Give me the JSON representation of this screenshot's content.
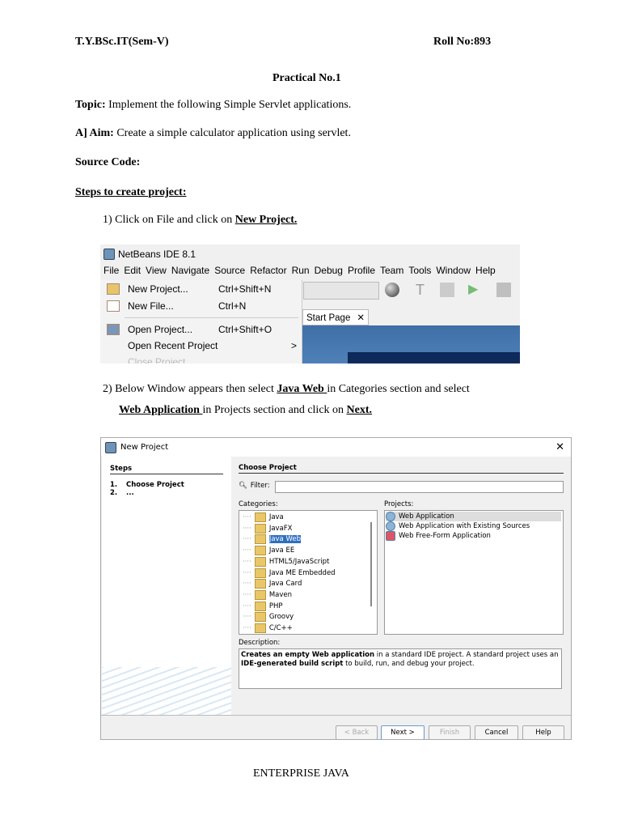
{
  "header": {
    "class": "T.Y.BSc.IT(Sem-V)",
    "roll": "Roll No:893"
  },
  "title": "Practical No.1",
  "topic": {
    "label": "Topic:",
    "text": " Implement the following Simple Servlet applications."
  },
  "aim": {
    "label": "A] Aim:",
    "text": " Create a simple calculator application using servlet."
  },
  "source_code": "Source Code:",
  "steps_heading": "Steps to create project:",
  "step1": {
    "text": "1) Click on File and click on ",
    "link": "New Project."
  },
  "step2": {
    "a": "2) Below Window appears then select ",
    "b": "Java Web ",
    "c": "in Categories  section and select",
    "d": "Web Application ",
    "e": "in Projects section and  click on ",
    "f": "Next."
  },
  "ide": {
    "title": "NetBeans IDE 8.1",
    "menu": [
      "File",
      "Edit",
      "View",
      "Navigate",
      "Source",
      "Refactor",
      "Run",
      "Debug",
      "Profile",
      "Team",
      "Tools",
      "Window",
      "Help"
    ],
    "file_menu": [
      {
        "label": "New Project...",
        "key": "Ctrl+Shift+N"
      },
      {
        "label": "New File...",
        "key": "Ctrl+N"
      },
      {
        "label": "Open Project...",
        "key": "Ctrl+Shift+O"
      },
      {
        "label": "Open Recent Project",
        "key": ">"
      },
      {
        "label": "Close Project",
        "key": ""
      }
    ],
    "tab": "Start Page"
  },
  "dialog": {
    "title": "New Project",
    "steps_heading": "Steps",
    "steps": [
      {
        "n": "1.",
        "label": "Choose Project"
      },
      {
        "n": "2.",
        "label": "..."
      }
    ],
    "heading": "Choose Project",
    "filter_label": "Filter:",
    "filter_value": "",
    "categories_label": "Categories:",
    "projects_label": "Projects:",
    "categories": [
      "Java",
      "JavaFX",
      "Java Web",
      "Java EE",
      "HTML5/JavaScript",
      "Java ME Embedded",
      "Java Card",
      "Maven",
      "PHP",
      "Groovy",
      "C/C++"
    ],
    "selected_category": "Java Web",
    "projects": [
      "Web Application",
      "Web Application with Existing Sources",
      "Web Free-Form Application"
    ],
    "description_label": "Description:",
    "description": {
      "b1": "Creates an empty Web application",
      "t1": " in a standard IDE project. A standard project uses an ",
      "b2": "IDE-generated build script",
      "t2": " to build, run, and debug your project."
    },
    "buttons": {
      "back": "< Back",
      "next": "Next >",
      "finish": "Finish",
      "cancel": "Cancel",
      "help": "Help"
    }
  },
  "footer": "ENTERPRISE JAVA"
}
